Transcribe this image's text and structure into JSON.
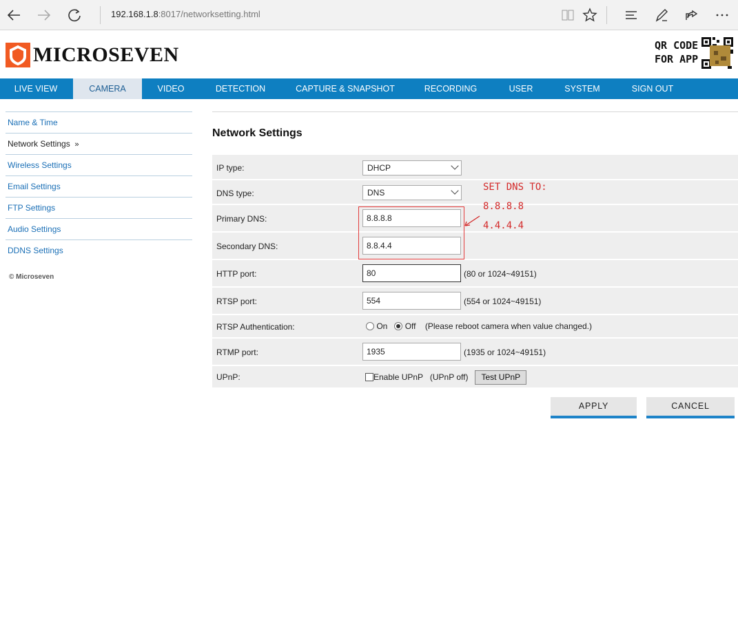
{
  "browser": {
    "url_host": "192.168.1.8",
    "url_path": ":8017/networksetting.html"
  },
  "header": {
    "brand": "MICROSEVEN",
    "qr_line1": "QR CODE",
    "qr_line2": "FOR APP"
  },
  "nav": {
    "items": [
      "LIVE VIEW",
      "CAMERA",
      "VIDEO",
      "DETECTION",
      "CAPTURE & SNAPSHOT",
      "RECORDING",
      "USER",
      "SYSTEM",
      "SIGN OUT"
    ],
    "active": "CAMERA"
  },
  "sidebar": {
    "items": [
      "Name & Time",
      "Network Settings",
      "Wireless Settings",
      "Email Settings",
      "FTP Settings",
      "Audio Settings",
      "DDNS Settings"
    ],
    "current_marker": "»",
    "copyright": "© Microseven"
  },
  "page": {
    "title": "Network Settings"
  },
  "form": {
    "ip_type_label": "IP type:",
    "ip_type_value": "DHCP",
    "dns_type_label": "DNS type:",
    "dns_type_value": "DNS",
    "primary_dns_label": "Primary DNS:",
    "primary_dns_value": "8.8.8.8",
    "secondary_dns_label": "Secondary DNS:",
    "secondary_dns_value": "8.8.4.4",
    "http_port_label": "HTTP port:",
    "http_port_value": "80",
    "http_port_hint": "(80 or 1024~49151)",
    "rtsp_port_label": "RTSP port:",
    "rtsp_port_value": "554",
    "rtsp_port_hint": "(554 or 1024~49151)",
    "rtsp_auth_label": "RTSP Authentication:",
    "rtsp_auth_on": "On",
    "rtsp_auth_off": "Off",
    "rtsp_auth_selected": "Off",
    "rtsp_auth_hint": "(Please reboot camera when value changed.)",
    "rtmp_port_label": "RTMP port:",
    "rtmp_port_value": "1935",
    "rtmp_port_hint": "(1935 or 1024~49151)",
    "upnp_label": "UPnP:",
    "upnp_checkbox_label": "Enable UPnP",
    "upnp_status": "(UPnP off)",
    "upnp_test_button": "Test UPnP"
  },
  "annotation": {
    "line1": "SET DNS TO:",
    "line2": "8.8.8.8",
    "line3": "4.4.4.4",
    "color": "#d42a2a"
  },
  "actions": {
    "apply": "APPLY",
    "cancel": "CANCEL"
  },
  "colors": {
    "nav_bg": "#0e7fc1",
    "brand_orange": "#f15a22",
    "link_blue": "#1a6fb6"
  }
}
